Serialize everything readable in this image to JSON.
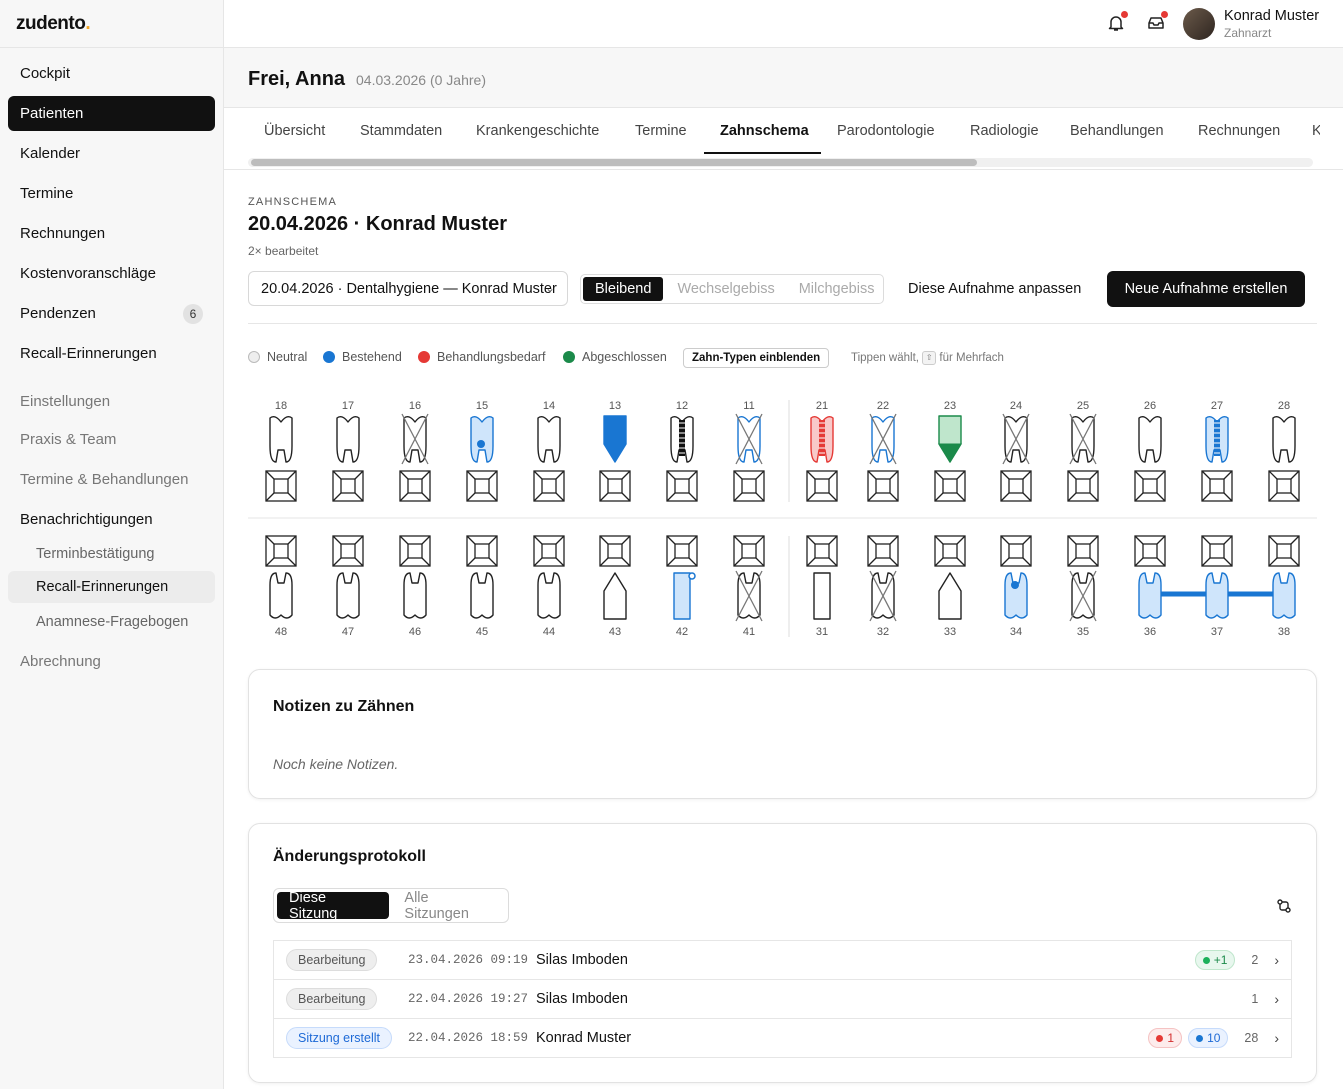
{
  "app": {
    "logo": "zudento",
    "logo_dot": "."
  },
  "sidebar": {
    "items": [
      {
        "label": "Cockpit"
      },
      {
        "label": "Patienten"
      },
      {
        "label": "Kalender"
      },
      {
        "label": "Termine"
      },
      {
        "label": "Rechnungen"
      },
      {
        "label": "Kostenvoranschläge"
      },
      {
        "label": "Pendenzen",
        "badge": "6"
      },
      {
        "label": "Recall-Erinnerungen"
      }
    ],
    "settings": [
      {
        "label": "Einstellungen"
      },
      {
        "label": "Praxis & Team"
      },
      {
        "label": "Termine & Behandlungen"
      },
      {
        "label": "Benachrichtigungen"
      },
      {
        "label": "Terminbestätigung"
      },
      {
        "label": "Recall-Erinnerungen"
      },
      {
        "label": "Anamnese-Fragebogen"
      },
      {
        "label": "Abrechnung"
      }
    ]
  },
  "user": {
    "name": "Konrad Muster",
    "role": "Zahnarzt"
  },
  "patient": {
    "name": "Frei, Anna",
    "dob": "04.03.2026 (0 Jahre)"
  },
  "tabs": [
    "Übersicht",
    "Stammdaten",
    "Krankengeschichte",
    "Termine",
    "Zahnschema",
    "Parodontologie",
    "Radiologie",
    "Behandlungen",
    "Rechnungen",
    "K"
  ],
  "schema": {
    "caption": "ZAHNSCHEMA",
    "title": "20.04.2026 · Konrad Muster",
    "edited": "2× bearbeitet",
    "select_value": "20.04.2026 · Dentalhygiene — Konrad Muster",
    "dentition": [
      "Bleibend",
      "Wechselgebiss",
      "Milchgebiss"
    ],
    "adjust_label": "Diese Aufnahme anpassen",
    "new_label": "Neue Aufnahme erstellen"
  },
  "legend": {
    "neutral": "Neutral",
    "existing": "Bestehend",
    "needs": "Behandlungsbedarf",
    "done": "Abgeschlossen",
    "toggle": "Zahn-Typen einblenden",
    "hint_a": "Tippen wählt,",
    "hint_key": "⇧",
    "hint_b": "für Mehrfach",
    "colors": {
      "neutral": "#e6e6e6",
      "existing": "#1976d2",
      "needs": "#e53935",
      "done": "#1b8a4a"
    }
  },
  "teeth": {
    "upper": [
      "18",
      "17",
      "16",
      "15",
      "14",
      "13",
      "12",
      "11",
      "21",
      "22",
      "23",
      "24",
      "25",
      "26",
      "27",
      "28"
    ],
    "lower": [
      "48",
      "47",
      "46",
      "45",
      "44",
      "43",
      "42",
      "41",
      "31",
      "32",
      "33",
      "34",
      "35",
      "36",
      "37",
      "38"
    ]
  },
  "notes": {
    "title": "Notizen zu Zähnen",
    "empty": "Noch keine Notizen."
  },
  "log": {
    "title": "Änderungsprotokoll",
    "tabs": [
      "Diese Sitzung",
      "Alle Sitzungen"
    ],
    "rows": [
      {
        "type": "Bearbeitung",
        "time": "23.04.2026 09:19",
        "user": "Silas Imboden",
        "count": "2",
        "green": "+1"
      },
      {
        "type": "Bearbeitung",
        "time": "22.04.2026 19:27",
        "user": "Silas Imboden",
        "count": "1"
      },
      {
        "type": "Sitzung erstellt",
        "time": "22.04.2026 18:59",
        "user": "Konrad Muster",
        "count": "28",
        "red": "1",
        "blue": "10"
      }
    ]
  }
}
